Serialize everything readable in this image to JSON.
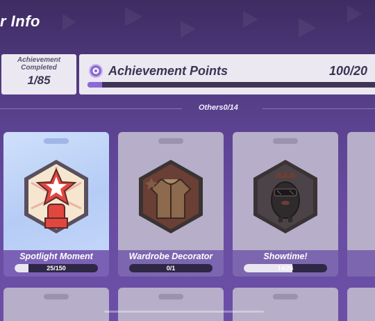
{
  "header": {
    "title": "r Info"
  },
  "summary": {
    "completed_label": "Achievement Completed",
    "completed_count": "1/85",
    "points_label": "Achievement Points",
    "points_value": "100/20",
    "points_progress": 0.05
  },
  "section": {
    "label": "Others0/14"
  },
  "achievements": [
    {
      "name": "Spotlight Moment",
      "progress_text": "25/150",
      "progress": 0.1667,
      "icon": "star-fist-icon",
      "state": "highlighted"
    },
    {
      "name": "Wardrobe Decorator",
      "progress_text": "0/1",
      "progress": 0.0,
      "icon": "jacket-icon",
      "state": "locked"
    },
    {
      "name": "Showtime!",
      "progress_text": "14/24",
      "progress": 0.5833,
      "icon": "sunglasses-creature-icon",
      "state": "locked"
    }
  ],
  "colors": {
    "accent": "#8b6ad6",
    "card_highlight": "#c2d5f9",
    "card_locked": "#b7aec9",
    "badge_red": "#e2473f",
    "badge_cream": "#f6e6cf"
  }
}
